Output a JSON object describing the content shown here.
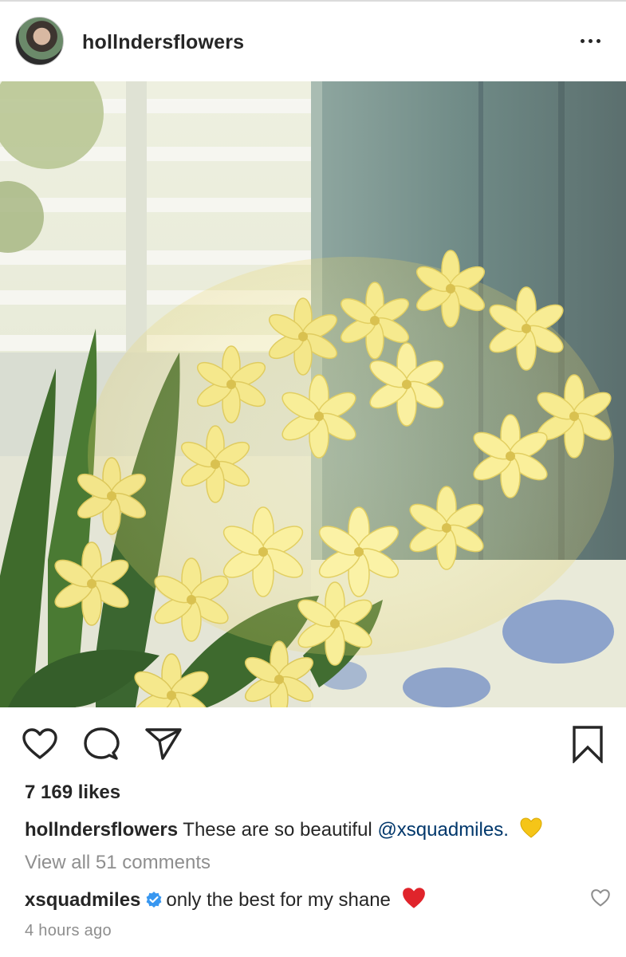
{
  "post": {
    "username": "hollndersflowers",
    "avatar_icon": "profile-avatar",
    "more_icon": "more-options-icon"
  },
  "actions": {
    "like_icon": "heart-outline-icon",
    "comment_icon": "comment-bubble-icon",
    "share_icon": "paper-plane-icon",
    "save_icon": "bookmark-icon"
  },
  "likes_text": "7 169 likes",
  "caption": {
    "username": "hollndersflowers",
    "text": "These are so beautiful",
    "mention": "@xsquadmiles.",
    "emoji": "yellow-heart",
    "emoji_color": "#f5c518"
  },
  "view_comments": "View all 51 comments",
  "top_comment": {
    "username": "xsquadmiles",
    "verified_color": "#3897f0",
    "text": "only the best for my shane",
    "emoji": "red-heart",
    "emoji_color": "#e0242b"
  },
  "timestamp": "4 hours ago",
  "colors": {
    "text": "#262626",
    "secondary": "#8e8e8e",
    "mention": "#00376b",
    "divider": "#dbdbdb"
  }
}
